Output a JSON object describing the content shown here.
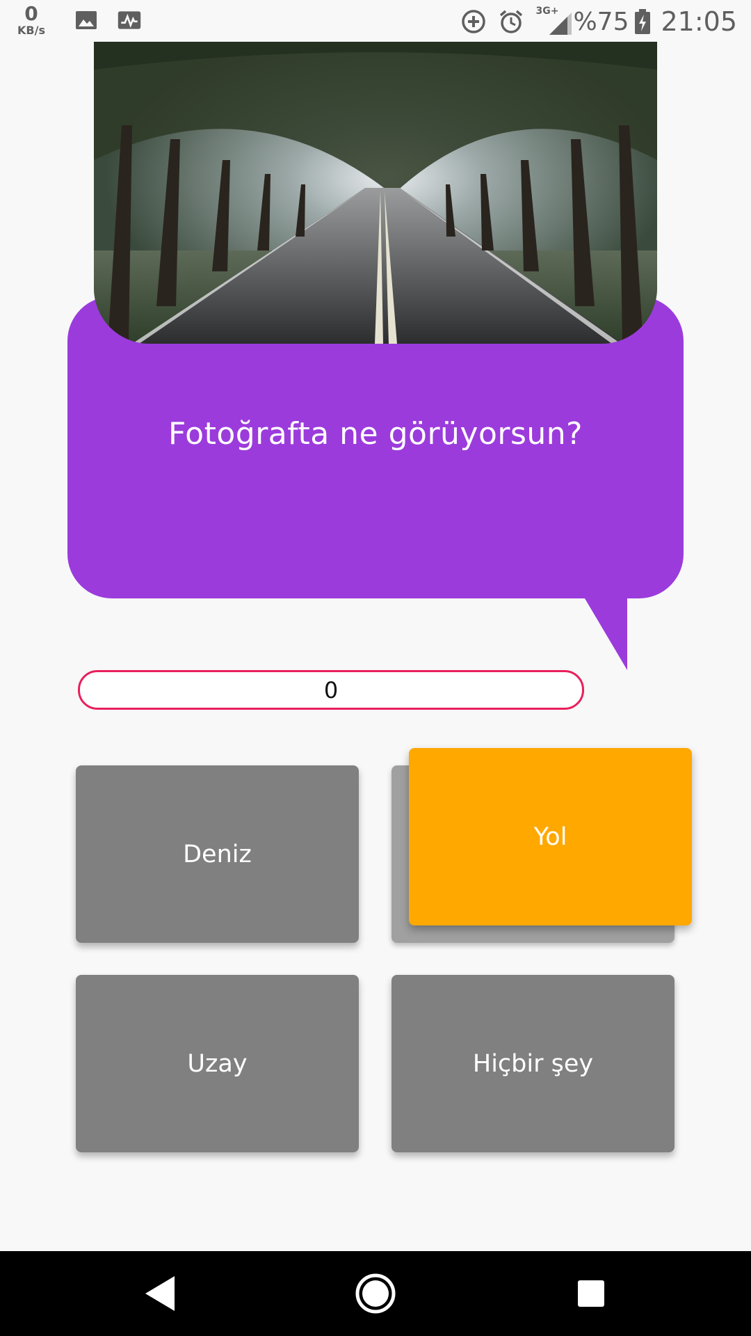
{
  "status_bar": {
    "speed_value": "0",
    "speed_unit": "KB/s",
    "battery": "%75",
    "time": "21:05",
    "network": "3G+",
    "icons": [
      "image-icon",
      "activity-icon",
      "data-saver-icon",
      "alarm-icon",
      "signal-icon",
      "battery-charging-icon"
    ]
  },
  "quiz": {
    "question": "Fotoğrafta ne görüyorsun?",
    "counter": "0",
    "answers": [
      {
        "label": "Deniz",
        "selected": false
      },
      {
        "label": "",
        "selected": false
      },
      {
        "label": "Yol",
        "selected": true
      },
      {
        "label": "Uzay",
        "selected": false
      },
      {
        "label": "Hiçbir şey",
        "selected": false
      }
    ],
    "colors": {
      "bubble": "#9b3bdc",
      "answer": "#808080",
      "selected": "#ffa800",
      "counter_border": "#e8205c"
    }
  },
  "nav": {
    "icons": [
      "back-icon",
      "home-icon",
      "recents-icon"
    ]
  }
}
